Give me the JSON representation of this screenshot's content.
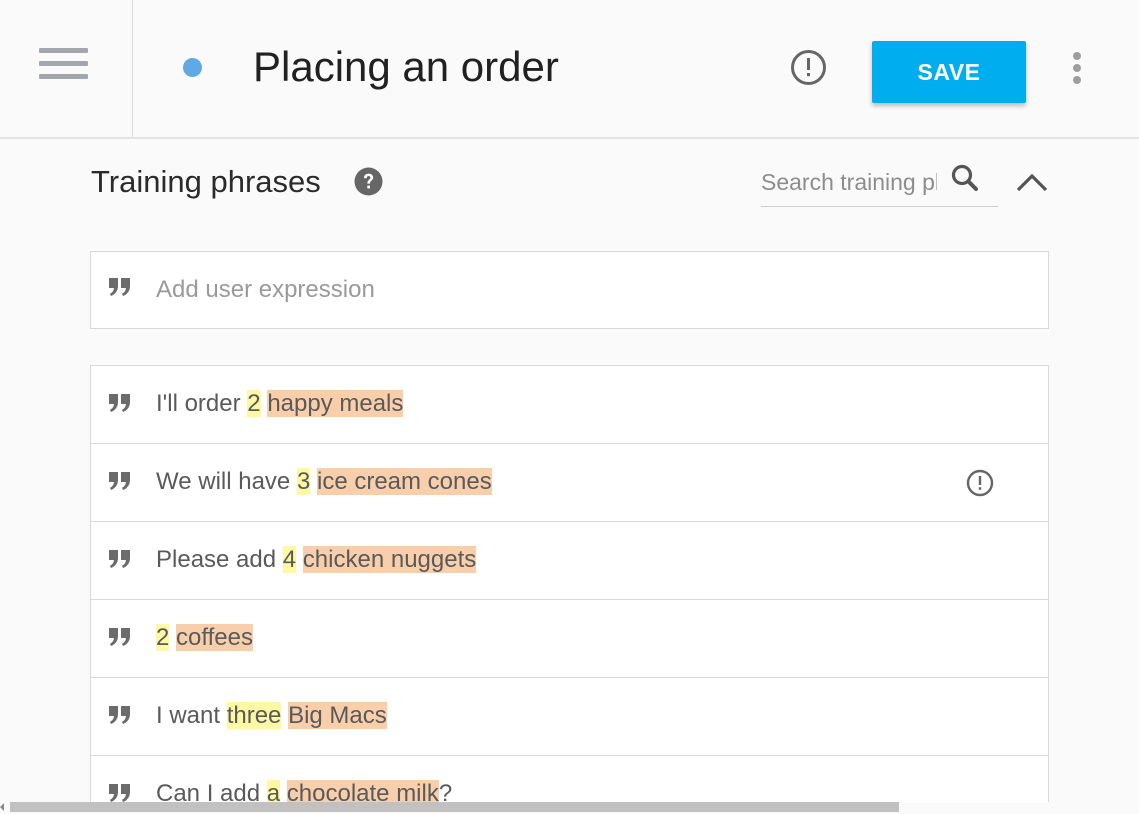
{
  "header": {
    "title": "Placing an order",
    "save_label": "SAVE",
    "status_dot_color": "#5ea9e6",
    "accent_color": "#00aeef"
  },
  "section": {
    "title": "Training phrases",
    "search_placeholder": "Search training phrases",
    "add_placeholder": "Add user expression"
  },
  "icons": {
    "menu": "hamburger-icon",
    "alert": "exclamation-circle-icon",
    "more": "vertical-dots-icon",
    "help": "question-circle-icon",
    "search": "magnifier-icon",
    "collapse": "chevron-up-icon",
    "quote": "quote-icon"
  },
  "phrases": [
    {
      "before": "I'll order ",
      "num": "2",
      "mid": " ",
      "item": "happy meals",
      "after": ""
    },
    {
      "before": "We will have ",
      "num": "3",
      "mid": " ",
      "item": "ice cream cones",
      "after": ""
    },
    {
      "before": "Please add ",
      "num": "4",
      "mid": " ",
      "item": "chicken nuggets",
      "after": ""
    },
    {
      "before": "",
      "num": "2",
      "mid": " ",
      "item": "coffees",
      "after": ""
    },
    {
      "before": "I want ",
      "num": "three",
      "mid": " ",
      "item": "Big Macs",
      "after": ""
    },
    {
      "before": "Can I add ",
      "num": "a",
      "mid": " ",
      "item": "chocolate milk",
      "after": "?"
    }
  ],
  "highlight_colors": {
    "number": "#fdf8a3",
    "item": "#f9cfab"
  }
}
